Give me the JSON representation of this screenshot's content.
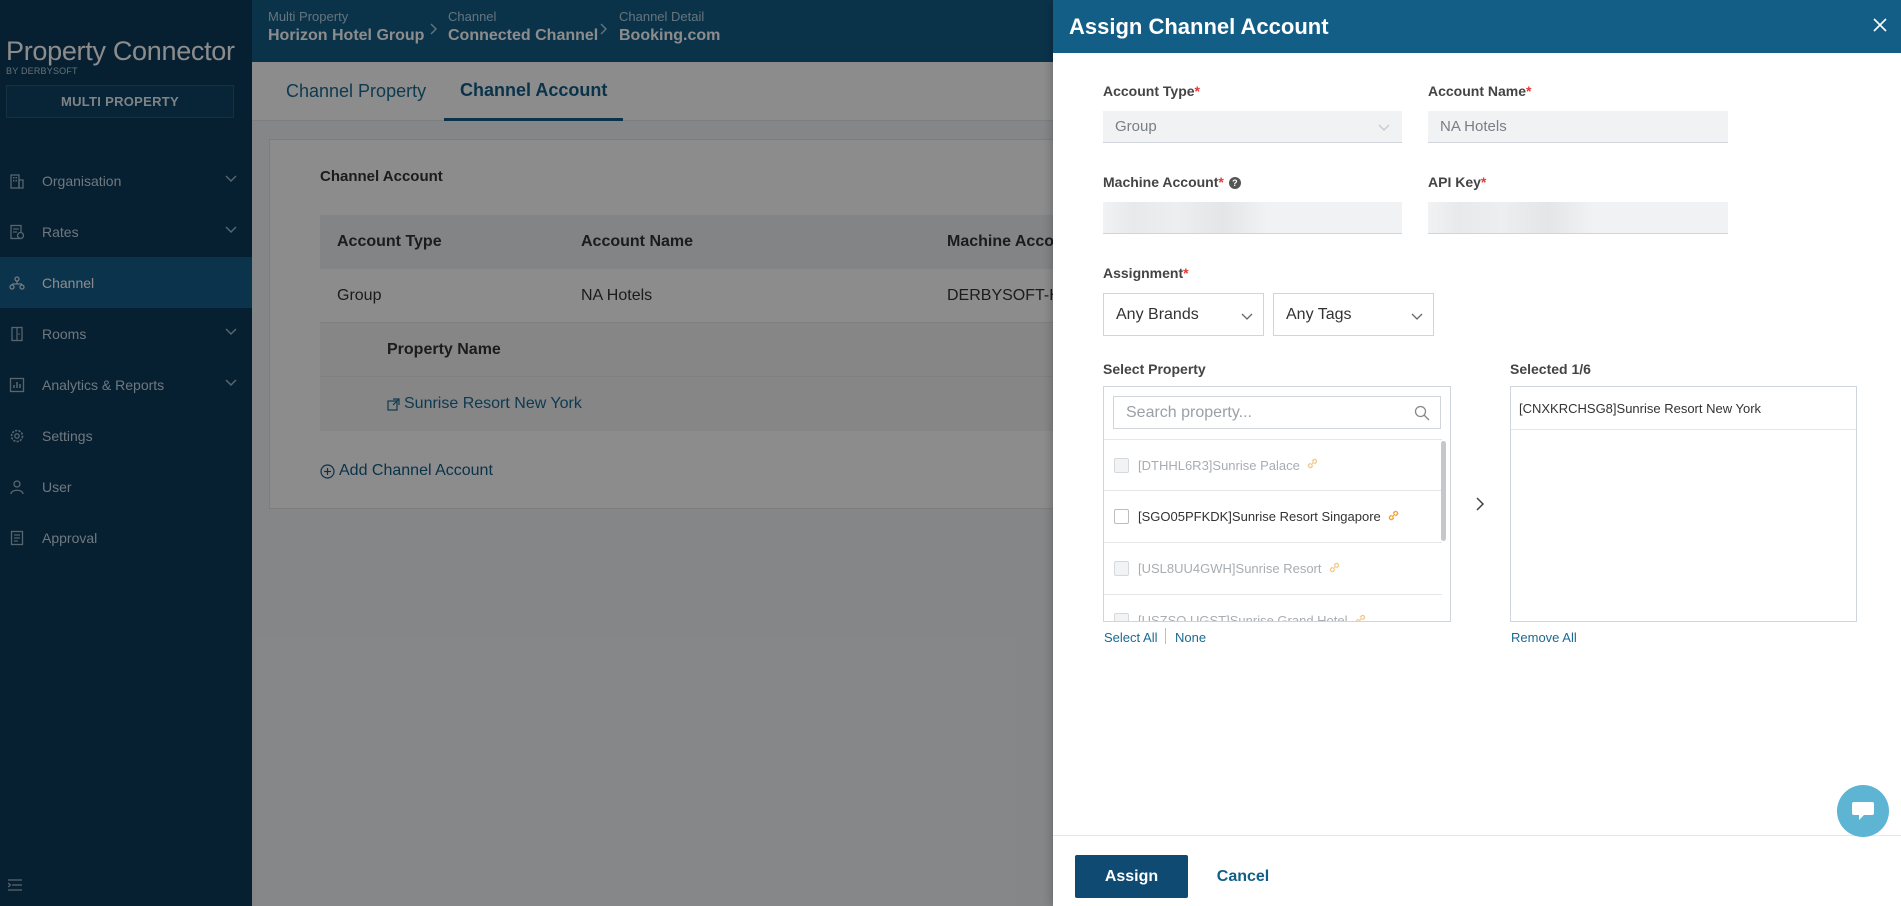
{
  "brand": {
    "name": "Property Connector",
    "sub": "BY DERBYSOFT",
    "mode": "MULTI PROPERTY"
  },
  "nav": [
    {
      "label": "Organisation",
      "icon": "building-icon",
      "chevron": true
    },
    {
      "label": "Rates",
      "icon": "rates-icon",
      "chevron": true
    },
    {
      "label": "Channel",
      "icon": "channel-icon",
      "chevron": false,
      "active": true
    },
    {
      "label": "Rooms",
      "icon": "door-icon",
      "chevron": true
    },
    {
      "label": "Analytics & Reports",
      "icon": "chart-icon",
      "chevron": true
    },
    {
      "label": "Settings",
      "icon": "gear-icon",
      "chevron": false
    },
    {
      "label": "User",
      "icon": "user-icon",
      "chevron": false
    },
    {
      "label": "Approval",
      "icon": "document-icon",
      "chevron": false
    }
  ],
  "breadcrumb": [
    {
      "small": "Multi Property",
      "big": "Horizon Hotel Group"
    },
    {
      "small": "Channel",
      "big": "Connected Channel"
    },
    {
      "small": "Channel Detail",
      "big": "Booking.com"
    }
  ],
  "tabs": [
    {
      "label": "Channel Property"
    },
    {
      "label": "Channel Account"
    }
  ],
  "card": {
    "title": "Channel Account",
    "headers": [
      "Account Type",
      "Account Name",
      "Machine Accou"
    ],
    "row": [
      "Group",
      "NA Hotels",
      "DERBYSOFT-HO"
    ],
    "sub_header": "Property Name",
    "sub_row": "Sunrise Resort New York",
    "add_label": "Add Channel Account"
  },
  "drawer": {
    "title": "Assign Channel Account",
    "account_type_label": "Account Type",
    "account_type_value": "Group",
    "account_name_label": "Account Name",
    "account_name_value": "NA Hotels",
    "machine_account_label": "Machine Account",
    "api_key_label": "API Key",
    "assignment_label": "Assignment",
    "brands_value": "Any Brands",
    "tags_value": "Any Tags",
    "select_property_label": "Select Property",
    "search_placeholder": "Search property...",
    "properties": [
      {
        "label": "[DTHHL6R3]Sunrise Palace",
        "disabled": true
      },
      {
        "label": "[SGO05PFKDK]Sunrise Resort Singapore",
        "disabled": false
      },
      {
        "label": "[USL8UU4GWH]Sunrise Resort",
        "disabled": true
      },
      {
        "label": "[USZSQ.UGST]Sunrise Grand Hotel",
        "disabled": true
      }
    ],
    "select_all": "Select All",
    "none": "None",
    "selected_label": "Selected 1/6",
    "selected_items": [
      "[CNXKRCHSG8]Sunrise Resort New York"
    ],
    "remove_all": "Remove All",
    "assign_button": "Assign",
    "cancel_button": "Cancel"
  },
  "colors": {
    "sidebar": "#0b3a59",
    "header": "#135e87",
    "primary_button": "#0e4a72",
    "required": "#e53935",
    "link_icon": "#e8a33d"
  }
}
